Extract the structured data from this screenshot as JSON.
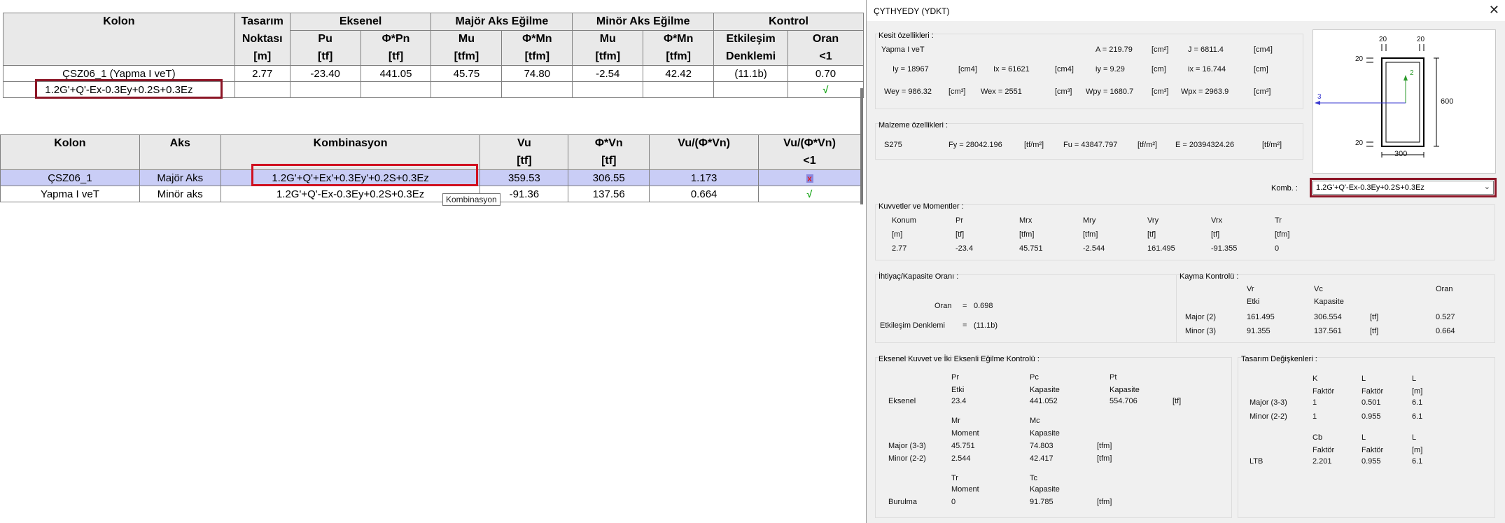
{
  "table1": {
    "headers_row1": [
      "Kolon",
      "Tasarım",
      "Eksenel",
      "Majör Aks Eğilme",
      "Minör Aks Eğilme",
      "Kontrol"
    ],
    "headers_row2": [
      "Noktası",
      "Pu",
      "Φ*Pn",
      "Mu",
      "Φ*Mn",
      "Mu",
      "Φ*Mn",
      "Etkileşim",
      "Oran"
    ],
    "headers_row3": [
      "[m]",
      "[tf]",
      "[tf]",
      "[tfm]",
      "[tfm]",
      "[tfm]",
      "[tfm]",
      "Denklemi",
      "<1"
    ],
    "row": {
      "kolon": "ÇSZ06_1 (Yapma I veT)",
      "nokta": "2.77",
      "pu": "-23.40",
      "phipn": "441.05",
      "mu_maj": "45.75",
      "phimn_maj": "74.80",
      "mu_min": "-2.54",
      "phimn_min": "42.42",
      "etkilesim": "(11.1b)",
      "oran": "0.70"
    },
    "combo": "1.2G'+Q'-Ex-0.3Ey+0.2S+0.3Ez",
    "check": "√"
  },
  "table2": {
    "headers_row1": [
      "Kolon",
      "Aks",
      "Kombinasyon",
      "Vu",
      "Φ*Vn",
      "Vu/(Φ*Vn)",
      "Vu/(Φ*Vn)"
    ],
    "headers_row2": [
      "[tf]",
      "[tf]",
      "<1"
    ],
    "rows": [
      {
        "kolon": "ÇSZ06_1",
        "aks": "Majör Aks",
        "komb": "1.2G'+Q'+Ex'+0.3Ey'+0.2S+0.3Ez",
        "vu": "359.53",
        "phivn": "306.55",
        "ratio": "1.173",
        "ok": "x"
      },
      {
        "kolon": "Yapma I veT",
        "aks": "Minör aks",
        "komb": "1.2G'+Q'-Ex-0.3Ey+0.2S+0.3Ez",
        "vu": "-91.36",
        "phivn": "137.56",
        "ratio": "0.664",
        "ok": "√"
      }
    ],
    "tooltip": "Kombinasyon"
  },
  "dialog": {
    "title": "ÇYTHYEDY (YDKT)",
    "close": "X",
    "kesit": {
      "label": "Kesit özellikleri :",
      "name": "Yapma I veT",
      "A": "A =  219.79",
      "A_u": "[cm²]",
      "J": "J =  6811.4",
      "J_u": "[cm4]",
      "Iy": "Iy =  18967",
      "Iy_u": "[cm4]",
      "Ix": "Ix =  61621",
      "Ix_u": "[cm4]",
      "iy": "iy =  9.29",
      "iy_u": "[cm]",
      "ix": "ix =  16.744",
      "ix_u": "[cm]",
      "Wey": "Wey =  986.32",
      "Wey_u": "[cm³]",
      "Wex": "Wex =  2551",
      "Wex_u": "[cm³]",
      "Wpy": "Wpy =  1680.7",
      "Wpy_u": "[cm³]",
      "Wpx": "Wpx =  2963.9",
      "Wpx_u": "[cm³]"
    },
    "malzeme": {
      "label": "Malzeme özellikleri :",
      "grade": "S275",
      "Fy": "Fy =  28042.196",
      "Fy_u": "[tf/m²]",
      "Fu": "Fu =  43847.797",
      "Fu_u": "[tf/m²]",
      "E": "E =  20394324.26",
      "E_u": "[tf/m²]"
    },
    "drawing": {
      "dim_top_left": "20",
      "dim_top_right": "20",
      "dim_side_top": "20",
      "dim_side_bottom": "20",
      "height": "600",
      "width": "300",
      "axis2": "2",
      "axis3": "3"
    },
    "komb": {
      "label": "Komb. :",
      "value": "1.2G'+Q'-Ex-0.3Ey+0.2S+0.3Ez",
      "chevron": "⌄"
    },
    "kuvvet": {
      "label": "Kuvvetler ve Momentler :",
      "headers": [
        "Konum",
        "Pr",
        "Mrx",
        "Mry",
        "Vry",
        "Vrx",
        "Tr"
      ],
      "units": [
        "[m]",
        "[tf]",
        "[tfm]",
        "[tfm]",
        "[tf]",
        "[tf]",
        "[tfm]"
      ],
      "values": [
        "2.77",
        "-23.4",
        "45.751",
        "-2.544",
        "161.495",
        "-91.355",
        "0"
      ]
    },
    "ihtiyac": {
      "label": "İhtiyaç/Kapasite Oranı :",
      "oran_label": "Oran",
      "eq": "=",
      "oran_value": "0.698",
      "etk_label": "Etkileşim Denklemi",
      "etk_eq": "=",
      "etk_value": "(11.1b)"
    },
    "kayma": {
      "label": "Kayma Kontrolü :",
      "h_vr": "Vr",
      "h_vc": "Vc",
      "h_oran": "Oran",
      "h_etki": "Etki",
      "h_kap": "Kapasite",
      "rows": [
        {
          "name": "Major (2)",
          "vr": "161.495",
          "vc": "306.554",
          "unit": "[tf]",
          "oran": "0.527"
        },
        {
          "name": "Minor (3)",
          "vr": "91.355",
          "vc": "137.561",
          "unit": "[tf]",
          "oran": "0.664"
        }
      ]
    },
    "eksenel": {
      "label": "Eksenel Kuvvet ve İki Eksenli Eğilme Kontrolü :",
      "h_pr": "Pr",
      "h_pc": "Pc",
      "h_pt": "Pt",
      "h_etki": "Etki",
      "h_kap": "Kapasite",
      "h_kap2": "Kapasite",
      "ek_label": "Eksenel",
      "ek_pr": "23.4",
      "ek_pc": "441.052",
      "ek_pt": "554.706",
      "ek_u": "[tf]",
      "h_mr": "Mr",
      "h_mc": "Mc",
      "h_moment": "Moment",
      "h_kap3": "Kapasite",
      "maj_label": "Major (3-3)",
      "maj_mr": "45.751",
      "maj_mc": "74.803",
      "maj_u": "[tfm]",
      "min_label": "Minor (2-2)",
      "min_mr": "2.544",
      "min_mc": "42.417",
      "min_u": "[tfm]",
      "h_tr": "Tr",
      "h_tc": "Tc",
      "h_moment2": "Moment",
      "h_kap4": "Kapasite",
      "bur_label": "Burulma",
      "bur_tr": "0",
      "bur_tc": "91.785",
      "bur_u": "[tfm]"
    },
    "tasarim": {
      "label": "Tasarım Değişkenleri :",
      "h_k": "K",
      "h_l": "L",
      "h_l2": "L",
      "h_faktor": "Faktör",
      "h_faktor2": "Faktör",
      "h_m": "[m]",
      "maj_label": "Major (3-3)",
      "maj_k": "1",
      "maj_l": "0.501",
      "maj_lm": "6.1",
      "min_label": "Minor (2-2)",
      "min_k": "1",
      "min_l": "0.955",
      "min_lm": "6.1",
      "h_cb": "Cb",
      "h_l3": "L",
      "h_l4": "L",
      "h_faktor3": "Faktör",
      "h_faktor4": "Faktör",
      "h_m2": "[m]",
      "ltb_label": "LTB",
      "ltb_cb": "2.201",
      "ltb_l": "0.955",
      "ltb_lm": "6.1"
    }
  }
}
